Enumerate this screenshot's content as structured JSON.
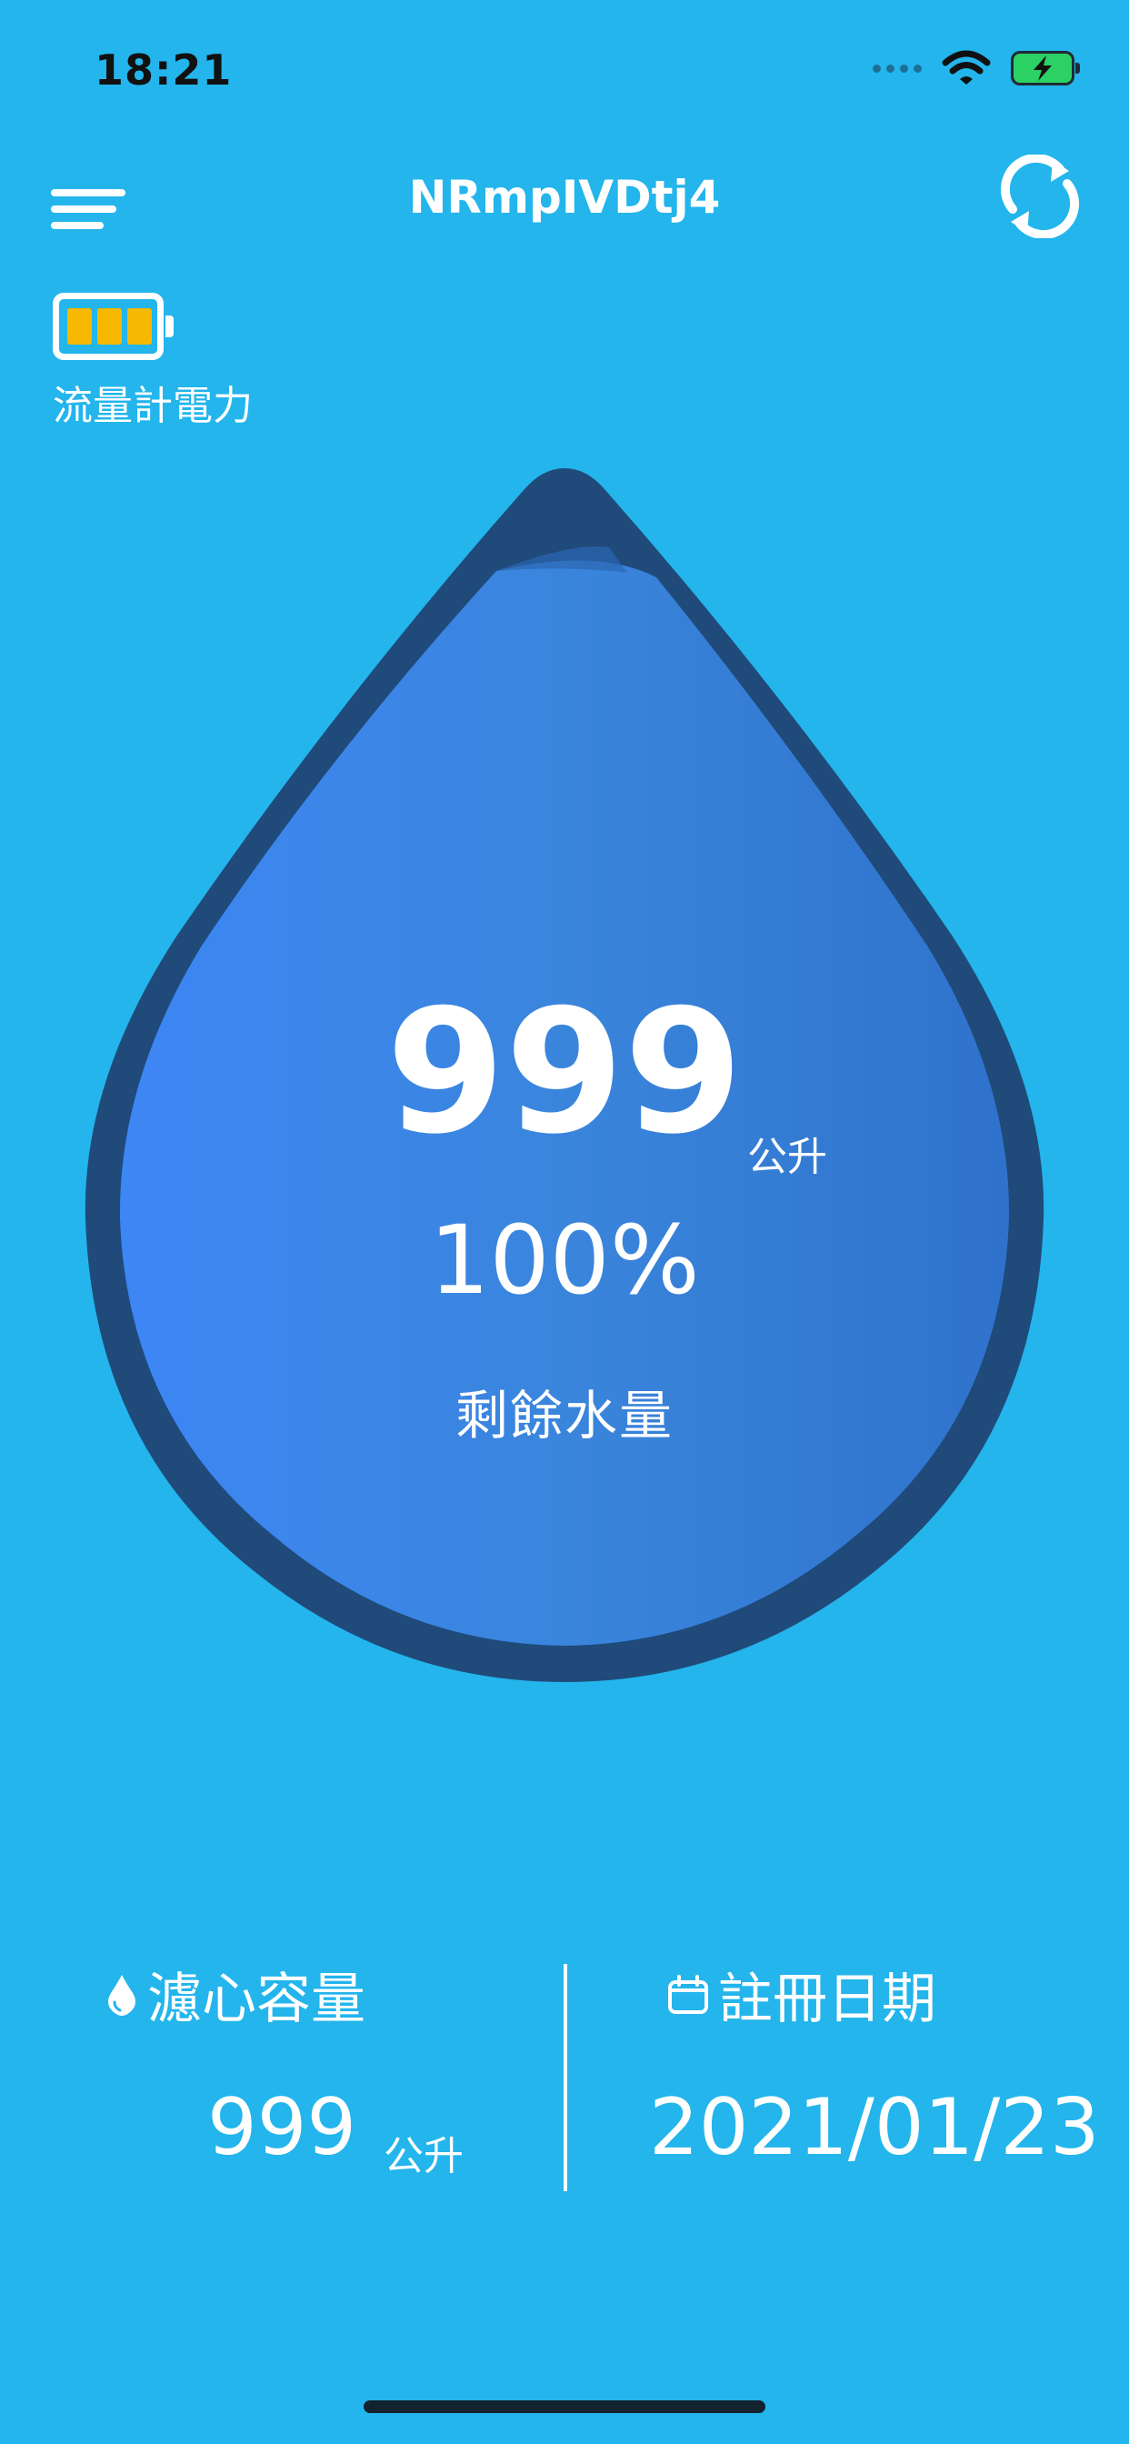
{
  "status_bar": {
    "time": "18:21"
  },
  "header": {
    "title": "NRmpIVDtj4",
    "menu_icon": "menu-icon",
    "refresh_icon": "refresh-icon"
  },
  "meter_battery": {
    "label": "流量計電力",
    "level": "3/3 bars",
    "cell_color": "#f6b800"
  },
  "water": {
    "remaining_litres": "999",
    "unit": "公升",
    "percent": "100%",
    "remaining_label": "剩餘水量",
    "fill_fraction": 1.0
  },
  "stats": {
    "filter_capacity": {
      "title": "濾心容量",
      "value": "999",
      "unit": "公升",
      "icon": "water-drop-icon"
    },
    "registration_date": {
      "title": "註冊日期",
      "value": "2021/01/23",
      "icon": "calendar-icon"
    }
  },
  "colors": {
    "background": "#23b5ec",
    "drop_outline": "#1f4a7a",
    "drop_fill_start": "#3d86f5",
    "drop_fill_end": "#2f72cc"
  }
}
